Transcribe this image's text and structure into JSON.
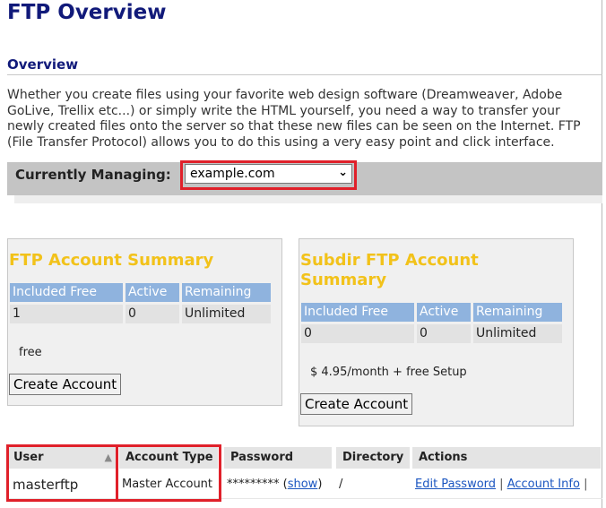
{
  "page": {
    "title": "FTP Overview"
  },
  "overview": {
    "heading": "Overview",
    "intro": "Whether you create files using your favorite web design software (Dreamweaver, Adobe GoLive, Trellix etc...) or simply write the HTML yourself, you need a way to transfer your newly created files onto the server so that these new files can be seen on the Internet. FTP (File Transfer Protocol) allows you to do this using a very easy point and click interface."
  },
  "managing": {
    "label": "Currently Managing:",
    "selected_domain": "example.com"
  },
  "ftp_summary": {
    "title": "FTP Account Summary",
    "headers": [
      "Included Free",
      "Active",
      "Remaining"
    ],
    "values": [
      "1",
      "0",
      "Unlimited"
    ],
    "note": "free",
    "button": "Create Account"
  },
  "subdir_summary": {
    "title": "Subdir FTP Account Summary",
    "headers": [
      "Included Free",
      "Active",
      "Remaining"
    ],
    "values": [
      "0",
      "0",
      "Unlimited"
    ],
    "note": "$ 4.95/month + free Setup",
    "button": "Create Account"
  },
  "accounts": {
    "columns": [
      "User",
      "Account Type",
      "Password",
      "Directory",
      "Actions"
    ],
    "rows": [
      {
        "user": "masterftp",
        "account_type": "Master Account",
        "password": "*********",
        "show": "show",
        "directory": "/",
        "actions": [
          "Edit Password",
          "Account Info"
        ]
      }
    ]
  },
  "colors": {
    "accent_title": "#111a7a",
    "panel_title": "#f2c21a",
    "table_header": "#8fb3de",
    "highlight": "#e0202a",
    "link": "#1a55c0"
  }
}
